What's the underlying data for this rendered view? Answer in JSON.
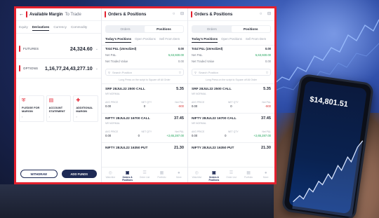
{
  "panel1": {
    "title": "Available Margin",
    "title_suffix": "To Trade",
    "tabs": [
      "Equity",
      "Derivatives",
      "Currency",
      "Commodity"
    ],
    "active_tab": "Derivatives",
    "rows": [
      {
        "label": "FUTURES",
        "value": "24,324.60"
      },
      {
        "label": "OPTIONS",
        "value": "1,16,77,24,43,277.10"
      }
    ],
    "cards": [
      {
        "icon": "pledge-icon",
        "label": "PLEDGE FOR MARGIN",
        "arrow": "›"
      },
      {
        "icon": "statement-icon",
        "label": "ACCOUNT STATEMENT",
        "arrow": "›"
      },
      {
        "icon": "margin-icon",
        "label": "ADDITIONAL MARGIN",
        "arrow": "›"
      }
    ],
    "withdraw_label": "WITHDRAW",
    "add_funds_label": "ADD FUNDS"
  },
  "positions": {
    "title": "Orders & Positions",
    "segment": [
      "Orders",
      "Positions"
    ],
    "tabs": [
      "Today's Positions",
      "Open Positions",
      "Sell From Dem"
    ],
    "pnl_rows": [
      {
        "label": "Total P&L (Unrealized)",
        "value": "0.00"
      },
      {
        "label": "Net P&L",
        "value": "5,63,930.00"
      },
      {
        "label": "Net Traded Value",
        "value": "0.00"
      }
    ],
    "search_placeholder": "Search Position",
    "note": "Long Press on the script to Square off All Order",
    "items": [
      {
        "name": "SRF 28JUL22 2500 CALL",
        "sub": "NR   NORMAL",
        "ltp": "5.35",
        "h1": "AVG PRICE",
        "h2": "NET QTY",
        "h3": "Net P&L",
        "v1": "0.00",
        "v2": "0",
        "v3": "-900"
      },
      {
        "name": "NIFTY 28JUL22 16700 CALL",
        "sub": "NR   NORMAL",
        "ltp": "37.45",
        "h1": "AVG PRICE",
        "h2": "NET QTY",
        "h3": "Net P&L",
        "v1": "0.00",
        "v2": "0",
        "v3": "+2,65,287.00"
      },
      {
        "name": "NIFTY 28JUL22 16350 PUT",
        "sub": "",
        "ltp": "21.30",
        "h1": "",
        "h2": "",
        "h3": "",
        "v1": "",
        "v2": "",
        "v3": ""
      }
    ],
    "nav": [
      "Watchlist",
      "Orders & Positions",
      "Order List",
      "Portfolio",
      "More"
    ],
    "nav_active": "Orders & Positions"
  },
  "phone": {
    "price": "$14,801.51"
  },
  "colors": {
    "accent": "#e3202e",
    "navy": "#1e2a55",
    "green": "#1ea35a"
  }
}
